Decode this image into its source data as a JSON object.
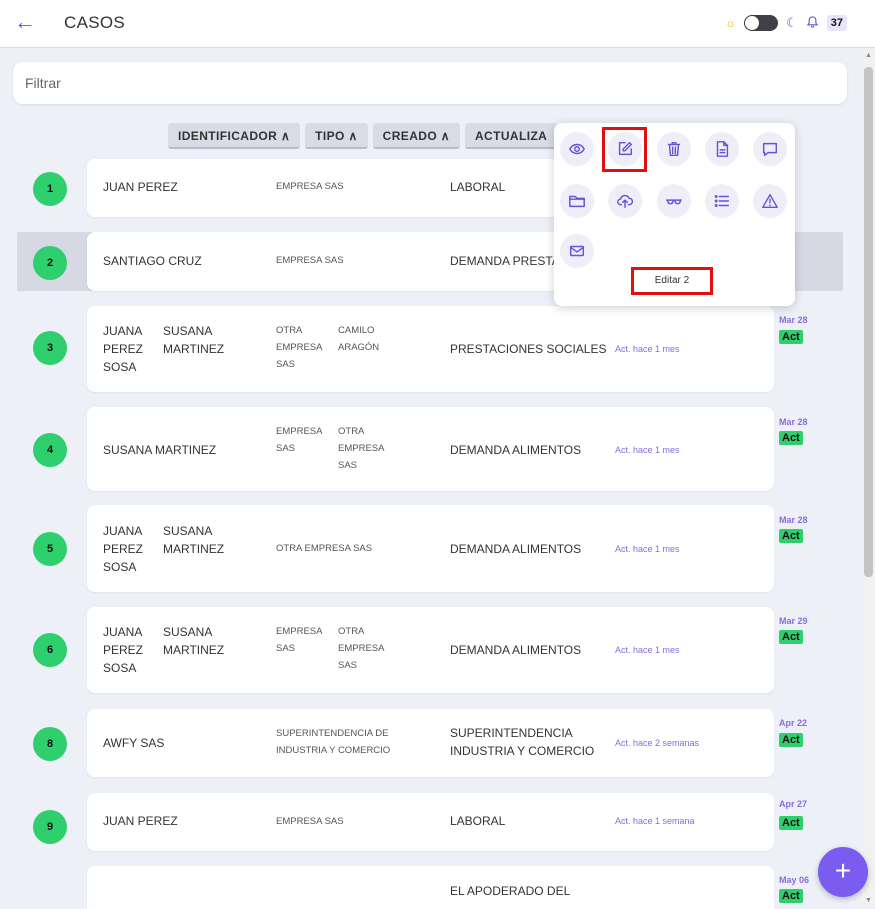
{
  "header": {
    "back_icon": "←",
    "title": "CASOS",
    "sun_icon": "☼",
    "moon_icon": "☾",
    "bell_icon": "🔔",
    "notif_count": "37"
  },
  "filter": {
    "placeholder": "Filtrar"
  },
  "sort": {
    "identificador": "IDENTIFICADOR",
    "tipo": "TIPO",
    "creado": "CREADO",
    "actualizado": "ACTUALIZA",
    "arrow": "∧"
  },
  "rows": [
    {
      "num": "1",
      "clients": [
        "JUAN PEREZ"
      ],
      "companies": [
        "EMPRESA SAS"
      ],
      "type": "LABORAL",
      "act": "",
      "date": "28",
      "tag": "ct"
    },
    {
      "num": "2",
      "clients": [
        "SANTIAGO CRUZ"
      ],
      "companies": [
        "EMPRESA SAS"
      ],
      "type": "DEMANDA PRESTAC",
      "act": "",
      "date": "28",
      "tag": "ct"
    },
    {
      "num": "3",
      "clients": [
        "JUANA PEREZ SOSA",
        "SUSANA MARTINEZ"
      ],
      "companies": [
        "OTRA EMPRESA SAS",
        "CAMILO ARAGÓN"
      ],
      "type": "PRESTACIONES SOCIALES",
      "act": "Act. hace 1 mes",
      "date": "Mar 28",
      "tag": "Act"
    },
    {
      "num": "4",
      "clients": [
        "SUSANA MARTINEZ"
      ],
      "companies": [
        "EMPRESA SAS",
        "OTRA EMPRESA SAS"
      ],
      "type": "DEMANDA ALIMENTOS",
      "act": "Act. hace 1 mes",
      "date": "Mar 28",
      "tag": "Act"
    },
    {
      "num": "5",
      "clients": [
        "JUANA PEREZ SOSA",
        "SUSANA MARTINEZ"
      ],
      "companies": [
        "OTRA EMPRESA SAS"
      ],
      "type": "DEMANDA ALIMENTOS",
      "act": "Act. hace 1 mes",
      "date": "Mar 28",
      "tag": "Act"
    },
    {
      "num": "6",
      "clients": [
        "JUANA PEREZ SOSA",
        "SUSANA MARTINEZ"
      ],
      "companies": [
        "EMPRESA SAS",
        "OTRA EMPRESA SAS"
      ],
      "type": "DEMANDA ALIMENTOS",
      "act": "Act. hace 1 mes",
      "date": "Mar 29",
      "tag": "Act"
    },
    {
      "num": "8",
      "clients": [
        "AWFY SAS"
      ],
      "companies": [
        "SUPERINTENDENCIA DE INDUSTRIA Y COMERCIO"
      ],
      "type": "SUPERINTENDENCIA INDUSTRIA Y COMERCIO",
      "act": "Act. hace 2 semanas",
      "date": "Apr 22",
      "tag": "Act"
    },
    {
      "num": "9",
      "clients": [
        "JUAN PEREZ"
      ],
      "companies": [
        "EMPRESA SAS"
      ],
      "type": "LABORAL",
      "act": "Act. hace 1 semana",
      "date": "Apr 27",
      "tag": "Act"
    },
    {
      "num": "",
      "clients": [],
      "companies": [],
      "type": "EL APODERADO DEL",
      "act": "",
      "date": "May 06",
      "tag": "Act"
    }
  ],
  "popup": {
    "tooltip": "Editar 2",
    "icons": [
      "eye-icon",
      "edit-icon",
      "trash-icon",
      "document-icon",
      "chat-icon",
      "folder-icon",
      "cloud-upload-icon",
      "glasses-icon",
      "list-icon",
      "warning-icon",
      "mail-icon"
    ]
  },
  "fab_label": "+",
  "colors": {
    "accent": "#6b50d8",
    "green": "#2ecf6c",
    "highlight": "#e01010"
  }
}
